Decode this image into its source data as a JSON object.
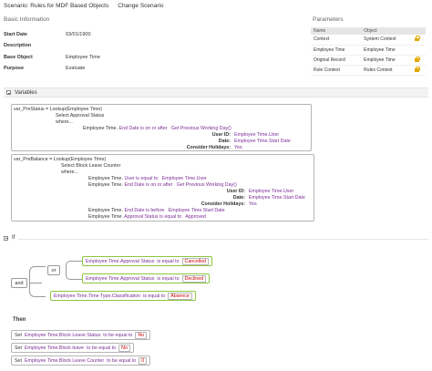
{
  "header": {
    "title": "Scenario: Rules for MDF Based Objects",
    "change_scenario": "Change Scenario"
  },
  "basic": {
    "title": "Basic Information",
    "rows": [
      {
        "label": "Start Date",
        "value": "03/01/1900"
      },
      {
        "label": "Description",
        "value": ""
      },
      {
        "label": "Base Object",
        "value": "Employee Time"
      },
      {
        "label": "Purpose",
        "value": "Evaluate"
      }
    ]
  },
  "parameters": {
    "title": "Parameters",
    "columns": [
      "Name",
      "Object"
    ],
    "rows": [
      {
        "name": "Context",
        "object": "System Context",
        "locked": true
      },
      {
        "name": "Employee Time",
        "object": "Employee Time",
        "locked": false
      },
      {
        "name": "Original Record",
        "object": "Employee Time",
        "locked": true
      },
      {
        "name": "Rule Context",
        "object": "Rules Context",
        "locked": true
      }
    ],
    "lock_color": "#e0a800"
  },
  "variables": {
    "section_label": "Variables",
    "var1": {
      "head_name": "var_PreStatus",
      "head_eq": " = ",
      "head_func": "Lookup(Employee Time)",
      "select": "Select Approval Status",
      "where": "where...",
      "r1_a": "Employee Time.",
      "r1_b": "End Date is on or after",
      "r1_c": "Get Previous Working Day()",
      "p1_label": "User ID:",
      "p1_value": "Employee Time.User",
      "p2_label": "Date:",
      "p2_value": "Employee Time.Start Date",
      "p3_label": "Consider Holidays:",
      "p3_value": "Yes"
    },
    "var2": {
      "head_name": "var_PreBalance",
      "head_eq": " = ",
      "head_func": "Lookup(Employee Time)",
      "select": "Select Block Leave Counter",
      "where": "where...",
      "r1_a": "Employee Time.",
      "r1_b": "User is equal to",
      "r1_c": "Employee Time.User",
      "r2_a": "Employee Time.",
      "r2_b": "End Date is on or after",
      "r2_c": "Get Previous Working Day()",
      "p1_label": "User ID:",
      "p1_value": "Employee Time.User",
      "p2_label": "Date:",
      "p2_value": "Employee Time.Start Date",
      "p3_label": "Consider Holidays:",
      "p3_value": "Yes",
      "r3_a": "Employee Time.",
      "r3_b": "End Date is before",
      "r3_c": "Employee Time.Start Date",
      "r4_a": "Employee Time.",
      "r4_b": "Approval Status is equal to",
      "r4_c": "Approved"
    }
  },
  "if_section": {
    "label": "If",
    "op_or": "or",
    "op_and": "and",
    "c1": {
      "field": "Employee Time.Approval Status",
      "op": "is equal to",
      "value": "Cancelled"
    },
    "c2": {
      "field": "Employee Time.Approval Status",
      "op": "is equal to",
      "value": "Declined"
    },
    "c3": {
      "field": "Employee Time.Time Type.Classification",
      "op": "is equal to",
      "value": "Absence"
    }
  },
  "then_section": {
    "label": "Then",
    "actions": [
      {
        "set": "Set",
        "field": "Employee Time.Block Leave Status",
        "op": "to be equal to",
        "value": "No"
      },
      {
        "set": "Set",
        "field": "Employee Time.Block leave",
        "op": "to be equal to",
        "value": "No"
      },
      {
        "set": "Set",
        "field": "Employee Time.Block Leave Counter",
        "op": "to be equal to",
        "value": "0"
      }
    ]
  },
  "colors": {
    "field_purple": "#7a2d96",
    "condition_green": "#8cc63f",
    "value_red": "#cc0000"
  }
}
